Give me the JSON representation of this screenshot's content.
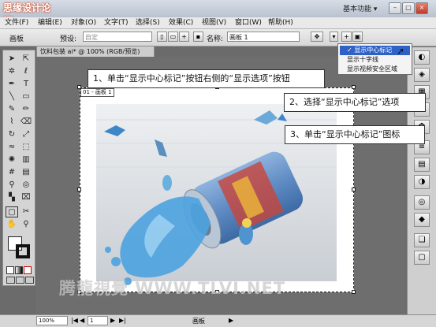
{
  "app": {
    "logo_text": "思缘设计论坛",
    "workspace_label": "基本功能 ▾",
    "window_buttons": {
      "minimize": "–",
      "restore": "□",
      "close": "×"
    }
  },
  "menu": [
    "文件(F)",
    "编辑(E)",
    "对象(O)",
    "文字(T)",
    "选择(S)",
    "效果(C)",
    "视图(V)",
    "窗口(W)",
    "帮助(H)"
  ],
  "control_bar": {
    "tool_name": "画板",
    "preset_label": "预设:",
    "preset_value": "自定",
    "name_label": "名称:",
    "name_value": "画板 1"
  },
  "document": {
    "tab_title": "饮料包装 ai* @ 100% (RGB/预览)",
    "artboard_label": "01 - 画板 1"
  },
  "dropdown": {
    "items": [
      "✓ 显示中心标记",
      "显示十字线",
      "显示视频安全区域"
    ]
  },
  "callouts": {
    "step1": "1、单击“显示中心标记”按钮右侧的“显示选项”按钮",
    "step2": "2、选择“显示中心标记”选项",
    "step3": "3、单击“显示中心标记”图标"
  },
  "status": {
    "zoom": "100%",
    "page": "1",
    "artboard_status": "画板"
  },
  "watermark": "腾龍視覺 WWW.TLVI.NET",
  "colors": {
    "accent": "#2f62c7",
    "pool_blue": "#4da3e0",
    "can_blue": "#6b94c8"
  }
}
